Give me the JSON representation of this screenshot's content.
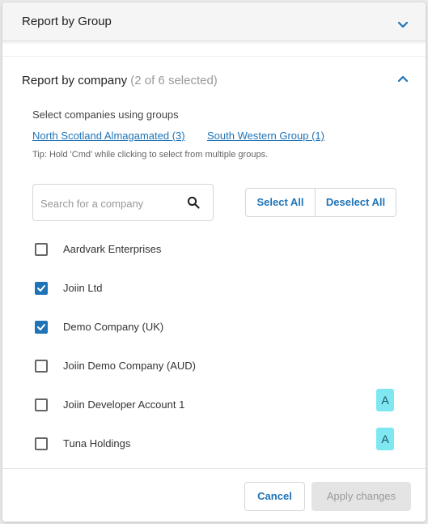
{
  "report_by_group": {
    "title": "Report by Group"
  },
  "report_by_company": {
    "title": "Report by company",
    "selection_count": "(2 of 6 selected)",
    "hint": "Select companies using groups",
    "groups": [
      {
        "label": "North Scotland Almagamated (3)"
      },
      {
        "label": "South Western Group (1)"
      }
    ],
    "tip": "Tip: Hold 'Cmd' while clicking to select from multiple groups.",
    "search_placeholder": "Search for a company",
    "select_all_label": "Select All",
    "deselect_all_label": "Deselect All",
    "companies": [
      {
        "name": "Aardvark Enterprises",
        "checked": false,
        "badge": ""
      },
      {
        "name": "Joiin Ltd",
        "checked": true,
        "badge": ""
      },
      {
        "name": "Demo Company (UK)",
        "checked": true,
        "badge": ""
      },
      {
        "name": "Joiin Demo Company (AUD)",
        "checked": false,
        "badge": ""
      },
      {
        "name": "Joiin Developer Account 1",
        "checked": false,
        "badge": "A"
      },
      {
        "name": "Tuna Holdings",
        "checked": false,
        "badge": "A"
      }
    ]
  },
  "footer": {
    "cancel_label": "Cancel",
    "apply_label": "Apply changes"
  },
  "icons": {
    "group_toggle": "chevron-down-icon",
    "company_toggle": "chevron-up-icon",
    "search": "search-icon",
    "checkbox_check": "checkmark-icon"
  },
  "colors": {
    "accent": "#1f73b7",
    "badge": "#7ee7f2",
    "disabled_button": "#e4e4e4"
  }
}
